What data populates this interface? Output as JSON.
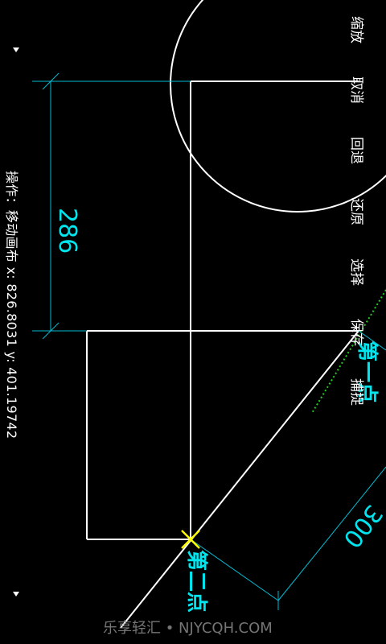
{
  "menu": {
    "zoom": "缩放",
    "cancel": "取消",
    "undo": "回退",
    "redo": "还原",
    "select": "选择",
    "save": "保存",
    "snap": "捕捉"
  },
  "status": {
    "text": "操作：移动画布  x:  826.8031  y: 401.19742"
  },
  "drawing": {
    "dimension_vertical": "286",
    "dimension_diagonal": "300",
    "first_point_label": "第一点",
    "second_point_label": "第二点"
  },
  "colors": {
    "background": "#000000",
    "geometry": "#ffffff",
    "dimension": "#00e5ee",
    "snap_marker": "#ffff00",
    "guide": "#22cc22"
  },
  "watermark": "乐享轻汇 • NJYCQH.COM"
}
